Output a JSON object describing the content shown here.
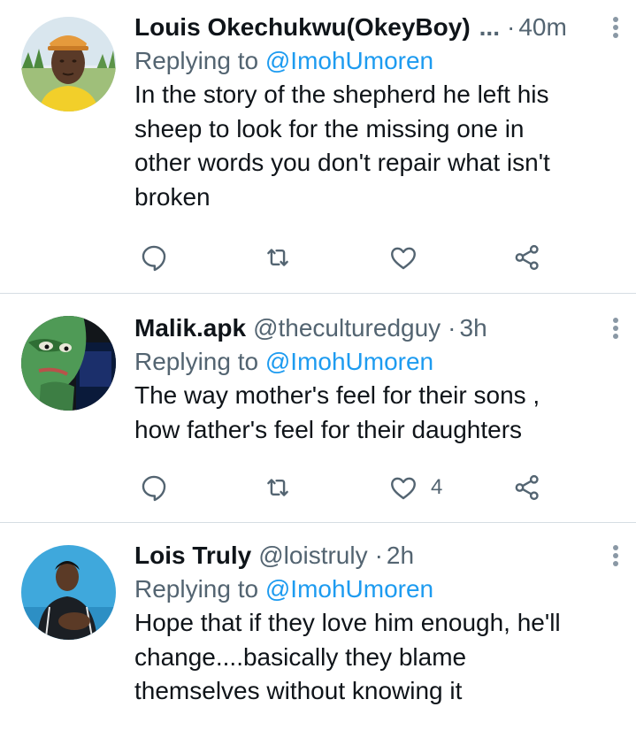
{
  "tweets": [
    {
      "display_name": "Louis Okechukwu(OkeyBoy)",
      "name_truncation": "...",
      "handle": "",
      "separator": "·",
      "time": "40m",
      "replying_prefix": "Replying to",
      "replying_to": "@ImohUmoren",
      "text": "In the story of the shepherd he left his\nsheep to look for the missing one in\nother words you don't repair what isn't\nbroken",
      "like_count": ""
    },
    {
      "display_name": "Malik.apk",
      "name_truncation": "",
      "handle": "@theculturedguy",
      "separator": "·",
      "time": "3h",
      "replying_prefix": "Replying to",
      "replying_to": "@ImohUmoren",
      "text": "The way mother's feel for their sons ,\nhow father's feel for their daughters",
      "like_count": "4"
    },
    {
      "display_name": "Lois Truly",
      "name_truncation": "",
      "handle": "@loistruly",
      "separator": "·",
      "time": "2h",
      "replying_prefix": "Replying to",
      "replying_to": "@ImohUmoren",
      "text": "Hope that if they love him enough, he'll\nchange....basically they blame\nthemselves without knowing it",
      "like_count": ""
    }
  ],
  "colors": {
    "text": "#0f1419",
    "secondary": "#536471",
    "link": "#1d9bf0",
    "divider": "#d6dde3"
  }
}
